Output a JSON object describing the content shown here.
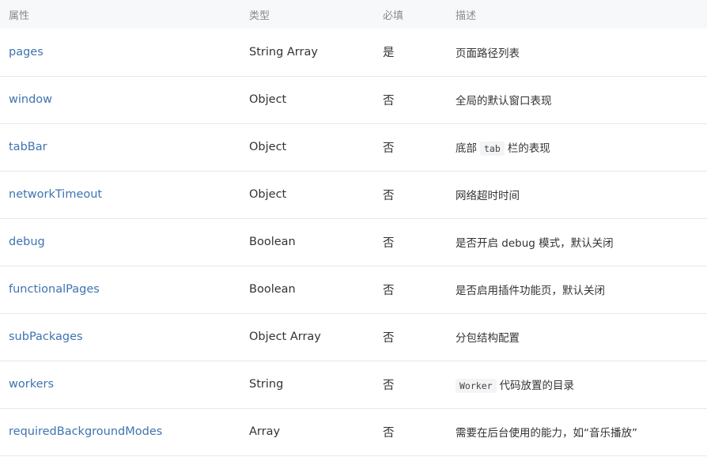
{
  "headers": {
    "property": "属性",
    "type": "类型",
    "required": "必填",
    "description": "描述"
  },
  "rows": [
    {
      "name": "pages",
      "type": "String Array",
      "required": "是",
      "desc": "页面路径列表"
    },
    {
      "name": "window",
      "type": "Object",
      "required": "否",
      "desc": "全局的默认窗口表现"
    },
    {
      "name": "tabBar",
      "type": "Object",
      "required": "否",
      "desc_before": "底部",
      "desc_code": "tab",
      "desc_after": "栏的表现"
    },
    {
      "name": "networkTimeout",
      "type": "Object",
      "required": "否",
      "desc": "网络超时时间"
    },
    {
      "name": "debug",
      "type": "Boolean",
      "required": "否",
      "desc": "是否开启 debug 模式，默认关闭"
    },
    {
      "name": "functionalPages",
      "type": "Boolean",
      "required": "否",
      "desc": "是否启用插件功能页，默认关闭"
    },
    {
      "name": "subPackages",
      "type": "Object Array",
      "required": "否",
      "desc": "分包结构配置"
    },
    {
      "name": "workers",
      "type": "String",
      "required": "否",
      "desc_code": "Worker",
      "desc_after": "代码放置的目录"
    },
    {
      "name": "requiredBackgroundModes",
      "type": "Array",
      "required": "否",
      "desc": "需要在后台使用的能力，如“音乐播放”"
    }
  ]
}
